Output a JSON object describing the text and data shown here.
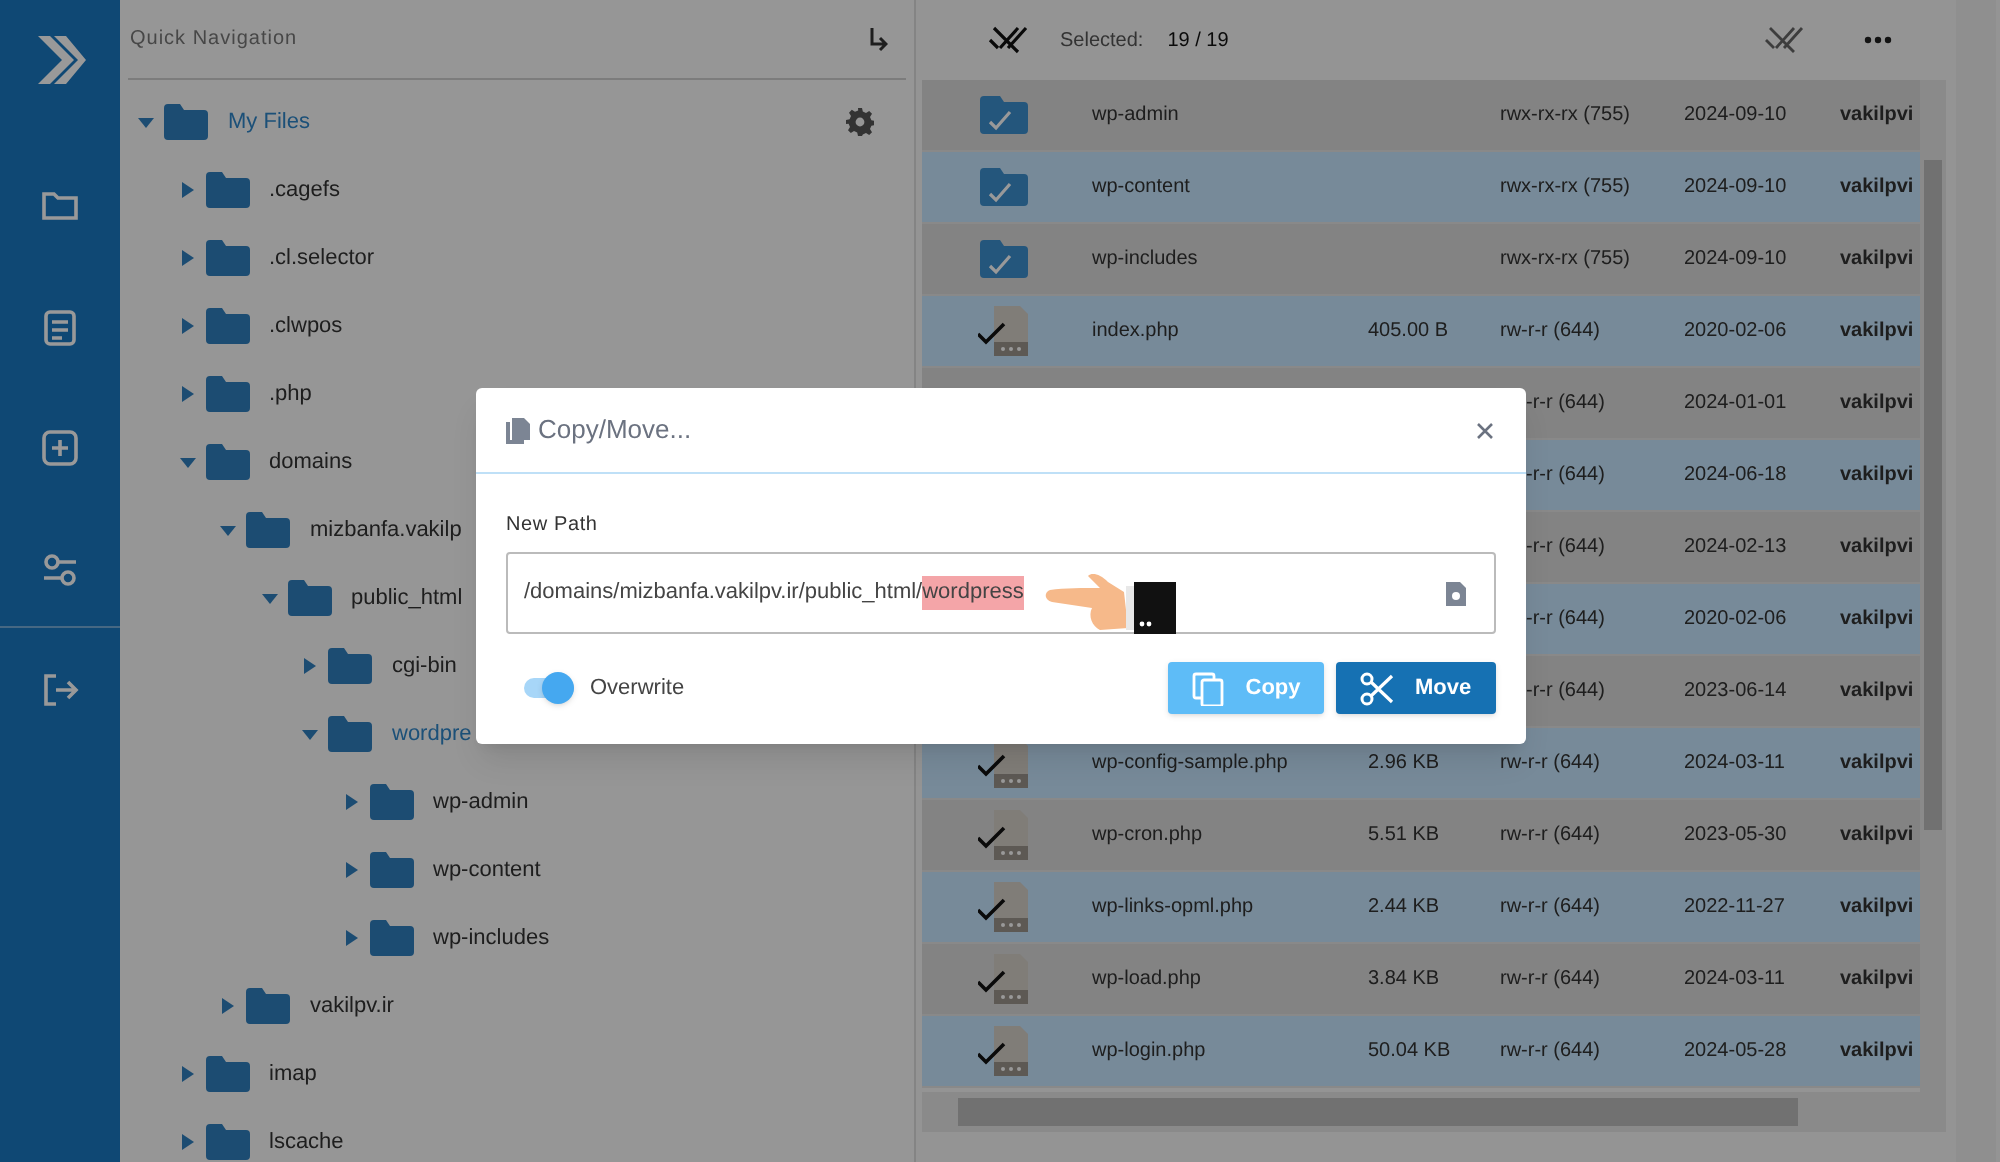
{
  "tree": {
    "title": "Quick Navigation",
    "root": {
      "label": "My Files",
      "expanded": true,
      "selected": true,
      "children": [
        {
          "label": ".cagefs",
          "expanded": false,
          "selected": false
        },
        {
          "label": ".cl.selector",
          "expanded": false,
          "selected": false
        },
        {
          "label": ".clwpos",
          "expanded": false,
          "selected": false
        },
        {
          "label": ".php",
          "expanded": false,
          "selected": false
        },
        {
          "label": "domains",
          "expanded": true,
          "selected": false,
          "children": [
            {
              "label": "mizbanfa.vakilp",
              "expanded": true,
              "selected": false,
              "children": [
                {
                  "label": "public_html",
                  "expanded": true,
                  "selected": false,
                  "children": [
                    {
                      "label": "cgi-bin",
                      "expanded": false,
                      "selected": false
                    },
                    {
                      "label": "wordpre",
                      "expanded": true,
                      "selected": true,
                      "children": [
                        {
                          "label": "wp-admin",
                          "expanded": false,
                          "selected": false
                        },
                        {
                          "label": "wp-content",
                          "expanded": false,
                          "selected": false
                        },
                        {
                          "label": "wp-includes",
                          "expanded": false,
                          "selected": false
                        }
                      ]
                    }
                  ]
                }
              ]
            },
            {
              "label": "vakilpv.ir",
              "expanded": false,
              "selected": false
            }
          ]
        },
        {
          "label": "imap",
          "expanded": false,
          "selected": false
        },
        {
          "label": "lscache",
          "expanded": false,
          "selected": false
        }
      ]
    }
  },
  "toolbar": {
    "label": "Selected:",
    "count": "19 / 19"
  },
  "rows": [
    {
      "kind": "folder",
      "name": "wp-admin",
      "permissions": "rwx-rx-rx (755)",
      "modified": "2024-09-10",
      "owner": "vakilpvi",
      "selected": true
    },
    {
      "kind": "folder",
      "name": "wp-content",
      "permissions": "rwx-rx-rx (755)",
      "modified": "2024-09-10",
      "owner": "vakilpvi",
      "selected": true
    },
    {
      "kind": "folder",
      "name": "wp-includes",
      "permissions": "rwx-rx-rx (755)",
      "modified": "2024-09-10",
      "owner": "vakilpvi",
      "selected": true
    },
    {
      "kind": "file",
      "name": "index.php",
      "size": "405.00 B",
      "permissions": "rw-r-r (644)",
      "modified": "2020-02-06",
      "owner": "vakilpvi",
      "selected": true
    },
    {
      "permissions": "-r-r (644)",
      "modified": "2024-01-01",
      "owner": "vakilpvi"
    },
    {
      "permissions": "-r-r (644)",
      "modified": "2024-06-18",
      "owner": "vakilpvi"
    },
    {
      "permissions": "-r-r (644)",
      "modified": "2024-02-13",
      "owner": "vakilpvi"
    },
    {
      "permissions": "-r-r (644)",
      "modified": "2020-02-06",
      "owner": "vakilpvi"
    },
    {
      "permissions": "-r-r (644)",
      "modified": "2023-06-14",
      "owner": "vakilpvi"
    },
    {
      "kind": "file",
      "name": "wp-config-sample.php",
      "size": "2.96 KB",
      "permissions": "rw-r-r (644)",
      "modified": "2024-03-11",
      "owner": "vakilpvi",
      "selected": true
    },
    {
      "kind": "file",
      "name": "wp-cron.php",
      "size": "5.51 KB",
      "permissions": "rw-r-r (644)",
      "modified": "2023-05-30",
      "owner": "vakilpvi",
      "selected": true
    },
    {
      "kind": "file",
      "name": "wp-links-opml.php",
      "size": "2.44 KB",
      "permissions": "rw-r-r (644)",
      "modified": "2022-11-27",
      "owner": "vakilpvi",
      "selected": true
    },
    {
      "kind": "file",
      "name": "wp-load.php",
      "size": "3.84 KB",
      "permissions": "rw-r-r (644)",
      "modified": "2024-03-11",
      "owner": "vakilpvi",
      "selected": true
    },
    {
      "kind": "file",
      "name": "wp-login.php",
      "size": "50.04 KB",
      "permissions": "rw-r-r (644)",
      "modified": "2024-05-28",
      "owner": "vakilpvi",
      "selected": true
    }
  ],
  "dialog": {
    "title": "Copy/Move...",
    "field_label": "New Path",
    "path": "/domains/mizbanfa.vakilpv.ir/public_html/",
    "highlighted": "wordpress",
    "overwrite": {
      "label": "Overwrite",
      "on": true
    },
    "buttons": [
      {
        "kind": "copy",
        "label": "Copy"
      },
      {
        "kind": "move",
        "label": "Move"
      }
    ]
  }
}
